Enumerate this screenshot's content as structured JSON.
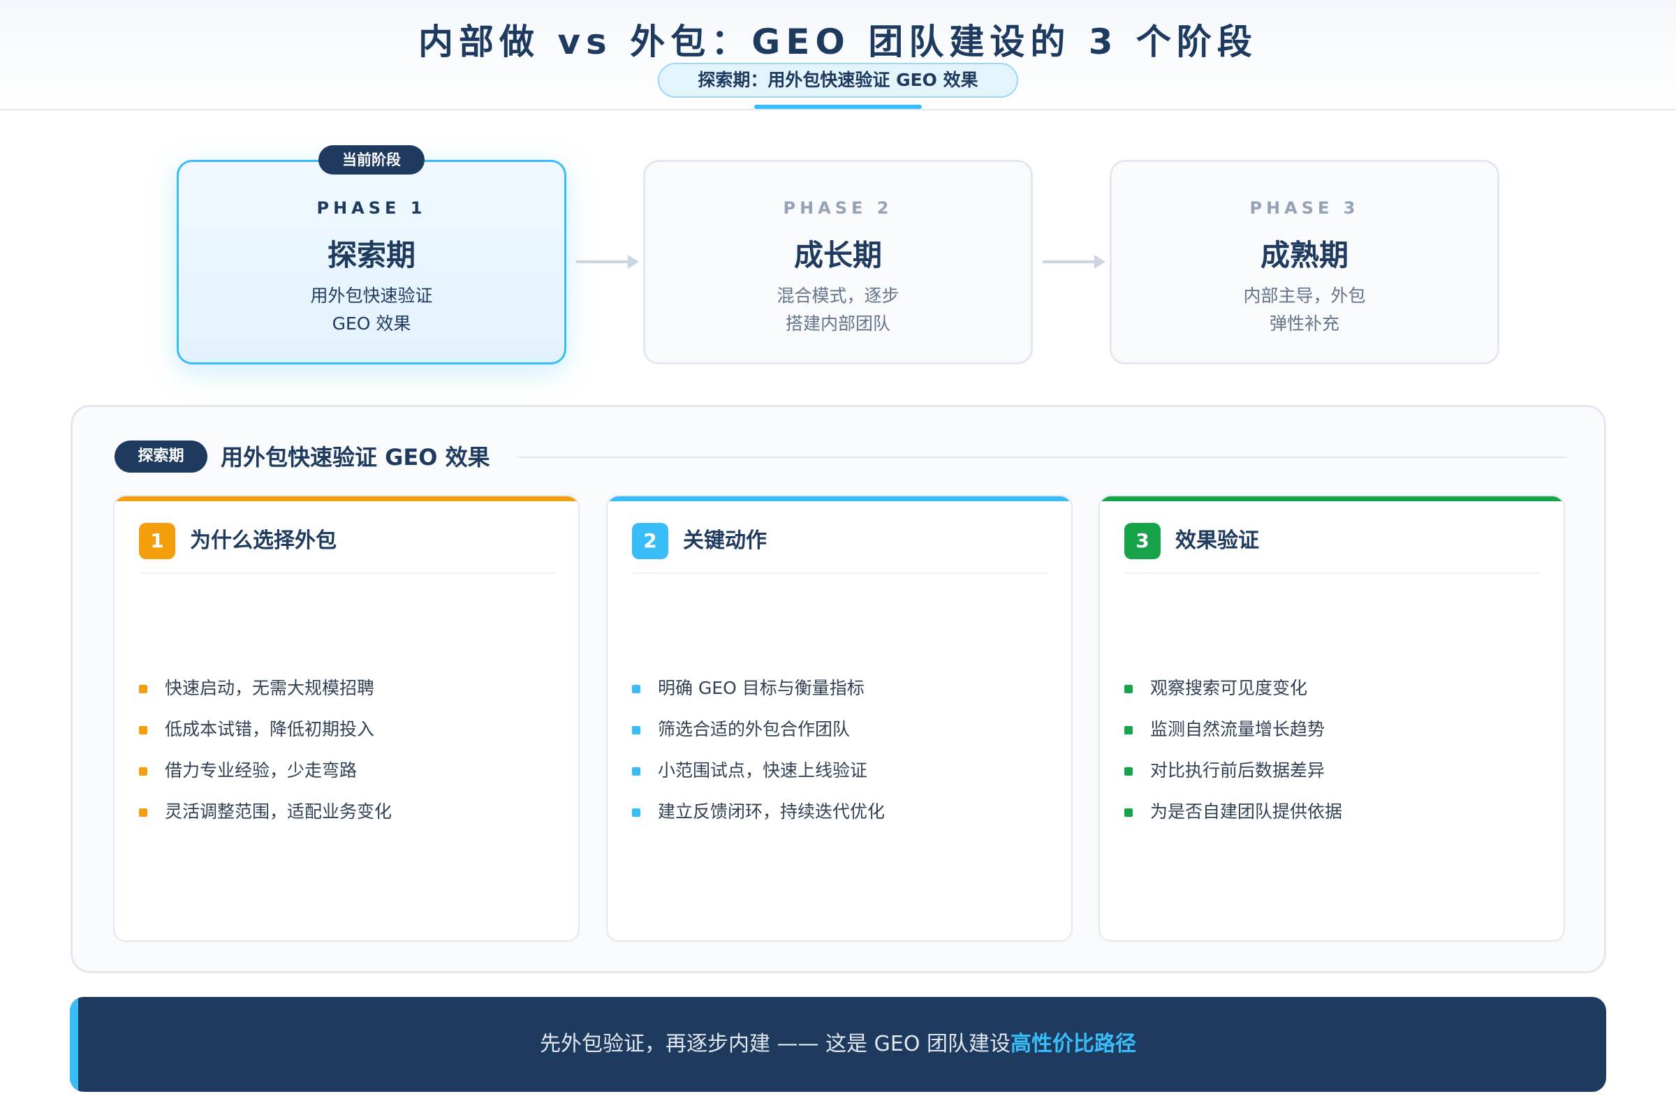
{
  "header": {
    "title": "内部做 vs 外包：GEO 团队建设的 3 个阶段",
    "subtitle": "探索期：用外包快速验证 GEO 效果"
  },
  "phases": [
    {
      "label": "PHASE 1",
      "name": "探索期",
      "desc_line1": "用外包快速验证",
      "desc_line2": "GEO 效果",
      "badge": "当前阶段",
      "active": true
    },
    {
      "label": "PHASE 2",
      "name": "成长期",
      "desc_line1": "混合模式，逐步",
      "desc_line2": "搭建内部团队",
      "active": false
    },
    {
      "label": "PHASE 3",
      "name": "成熟期",
      "desc_line1": "内部主导，外包",
      "desc_line2": "弹性补充",
      "active": false
    }
  ],
  "panel": {
    "tag": "探索期",
    "title": "用外包快速验证 GEO 效果",
    "columns": [
      {
        "number": "1",
        "title": "为什么选择外包",
        "color": "#f59e0b",
        "items": [
          "快速启动，无需大规模招聘",
          "低成本试错，降低初期投入",
          "借力专业经验，少走弯路",
          "灵活调整范围，适配业务变化"
        ]
      },
      {
        "number": "2",
        "title": "关键动作",
        "color": "#38bdf8",
        "items": [
          "明确 GEO 目标与衡量指标",
          "筛选合适的外包合作团队",
          "小范围试点，快速上线验证",
          "建立反馈闭环，持续迭代优化"
        ]
      },
      {
        "number": "3",
        "title": "效果验证",
        "color": "#16a34a",
        "items": [
          "观察搜索可见度变化",
          "监测自然流量增长趋势",
          "对比执行前后数据差异",
          "为是否自建团队提供依据"
        ]
      }
    ]
  },
  "banner": {
    "text": "先外包验证，再逐步内建 —— 这是 GEO 团队建设",
    "highlight": "高性价比路径"
  },
  "colors": {
    "navy": "#1e3a5f",
    "accent": "#38bdf8"
  }
}
